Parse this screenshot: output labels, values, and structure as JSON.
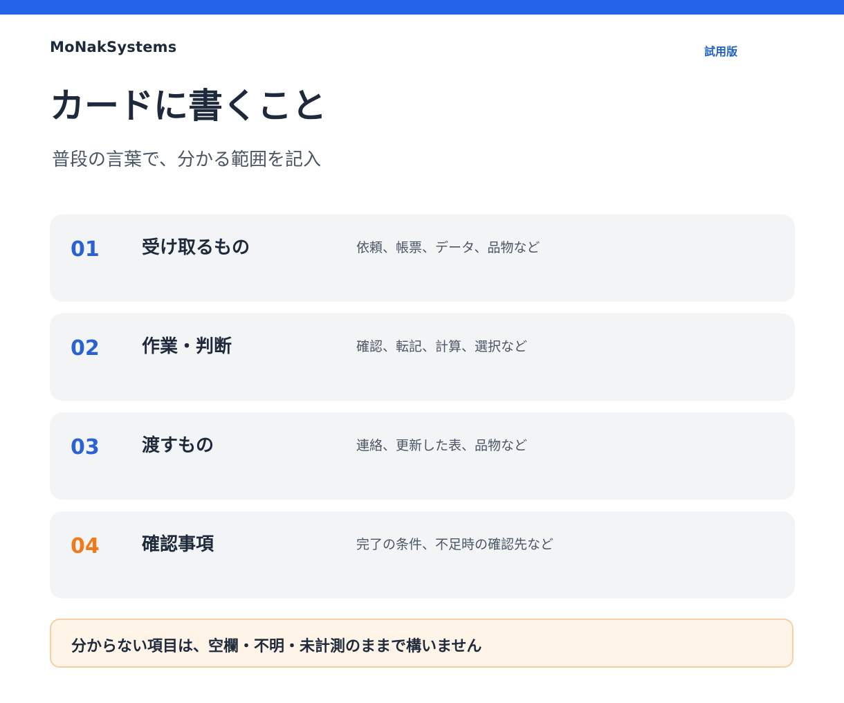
{
  "header": {
    "brand": "MoNakSystems",
    "badge": "試用版"
  },
  "page": {
    "title": "カードに書くこと",
    "subtitle": "普段の言葉で、分かる範囲を記入"
  },
  "cards": [
    {
      "number": "01",
      "heading": "受け取るもの",
      "description": "依頼、帳票、データ、品物など"
    },
    {
      "number": "02",
      "heading": "作業・判断",
      "description": "確認、転記、計算、選択など"
    },
    {
      "number": "03",
      "heading": "渡すもの",
      "description": "連絡、更新した表、品物など"
    },
    {
      "number": "04",
      "heading": "確認事項",
      "description": "完了の条件、不足時の確認先など"
    }
  ],
  "note": {
    "text": "分からない項目は、空欄・不明・未計測のままで構いません"
  },
  "colors": {
    "top_bar": "#2563eb",
    "number_blue": "#2a62d3",
    "number_orange": "#f07a1a",
    "card_bg": "#f2f4f6",
    "note_bg": "#fef4e8",
    "note_border": "#f7cfa0"
  }
}
